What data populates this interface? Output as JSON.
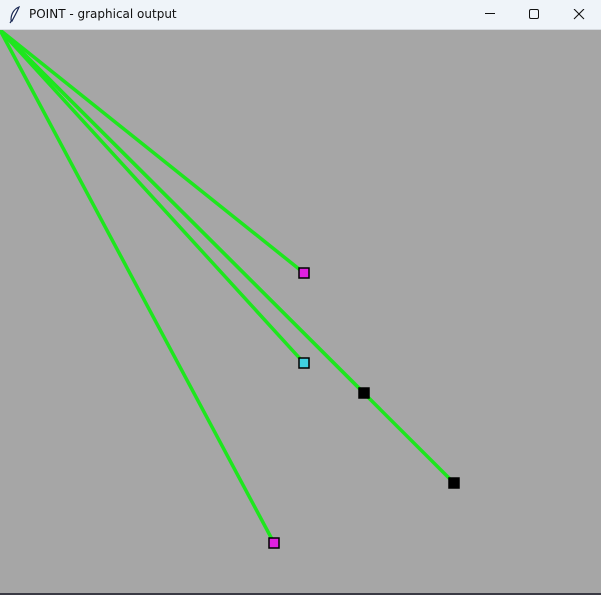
{
  "window": {
    "title": "POINT - graphical output",
    "app_icon": "feather-icon",
    "controls": [
      "minimize-icon",
      "maximize-icon",
      "close-icon"
    ]
  },
  "canvas": {
    "background": "#a6a6a6",
    "line_color": "#1ee61e",
    "links": [
      {
        "marker_color": "#e020e0"
      },
      {
        "marker_color": "#40d0e0"
      },
      {
        "marker_color": "#000000"
      },
      {
        "marker_color": "#000000"
      },
      {
        "marker_color": "#e020e0"
      }
    ]
  }
}
